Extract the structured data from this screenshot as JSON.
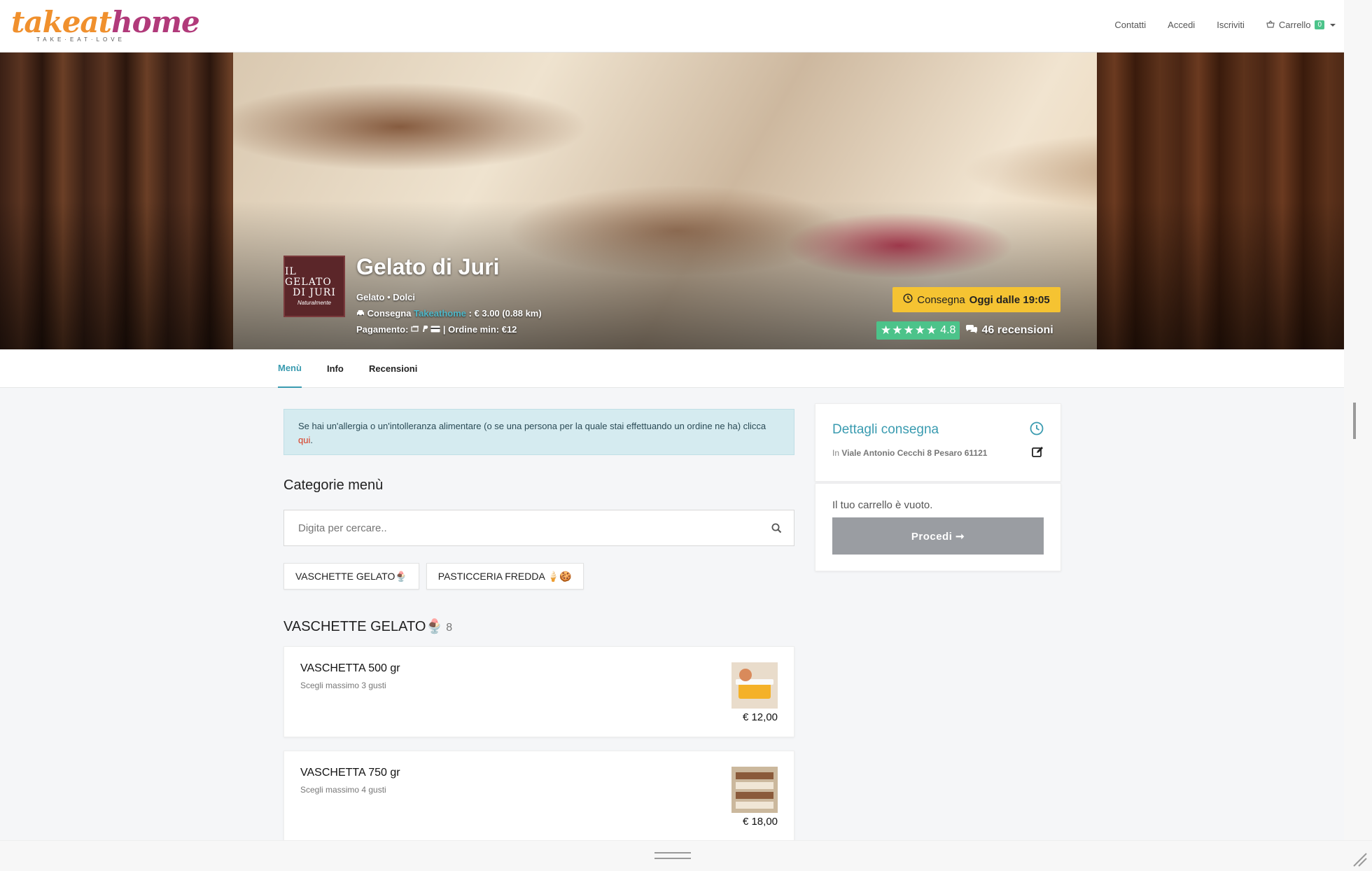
{
  "nav": {
    "logo_word_a": "takeat",
    "logo_word_b": "home",
    "logo_tagline": "TAKE·EAT·LOVE",
    "links": [
      "Contatti",
      "Accedi",
      "Iscriviti"
    ],
    "cart_label": "Carrello",
    "cart_count": "0"
  },
  "hero": {
    "logo_line1": "IL GELATO",
    "logo_line2": "DI JURI",
    "logo_line3": "Naturalmente",
    "name": "Gelato di Juri",
    "categories": "Gelato • Dolci",
    "delivery_prefix": "Consegna",
    "delivery_provider": "Takeathome",
    "delivery_cost": ": € 3.00 (0.88 km)",
    "payment_label": "Pagamento:",
    "min_order": "| Ordine min: €12",
    "delivery_pill_prefix": "Consegna",
    "delivery_pill_time": "Oggi dalle 19:05",
    "stars": "★★★★★",
    "rating": "4.8",
    "reviews": "46 recensioni"
  },
  "tabs": [
    "Menù",
    "Info",
    "Recensioni"
  ],
  "allergy": {
    "text": "Se hai un'allergia o un'intolleranza alimentare (o se una persona per la quale stai effettuando un ordine ne ha) clicca ",
    "link": "qui",
    "end": "."
  },
  "menu": {
    "title": "Categorie menù",
    "search_placeholder": "Digita per cercare..",
    "chips": [
      "VASCHETTE GELATO🍨",
      "PASTICCERIA FREDDA 🍦🍪"
    ],
    "category_title": "VASCHETTE GELATO🍨",
    "category_count": "8",
    "products": [
      {
        "name": "VASCHETTA 500 gr",
        "desc": "Scegli massimo 3 gusti",
        "price": "€ 12,00"
      },
      {
        "name": "VASCHETTA 750 gr",
        "desc": "Scegli massimo 4 gusti",
        "price": "€ 18,00"
      }
    ]
  },
  "sidebar": {
    "title": "Dettagli consegna",
    "addr_prefix": "In",
    "address": "Viale Antonio Cecchi 8 Pesaro 61121",
    "empty_cart": "Il tuo carrello è vuoto.",
    "proceed": "Procedi ➞"
  },
  "colors": {
    "accent": "#3a9bb0",
    "rating_green": "#4cc38a",
    "delivery_yellow": "#f5c332",
    "proceed_gray": "#9a9da2"
  }
}
